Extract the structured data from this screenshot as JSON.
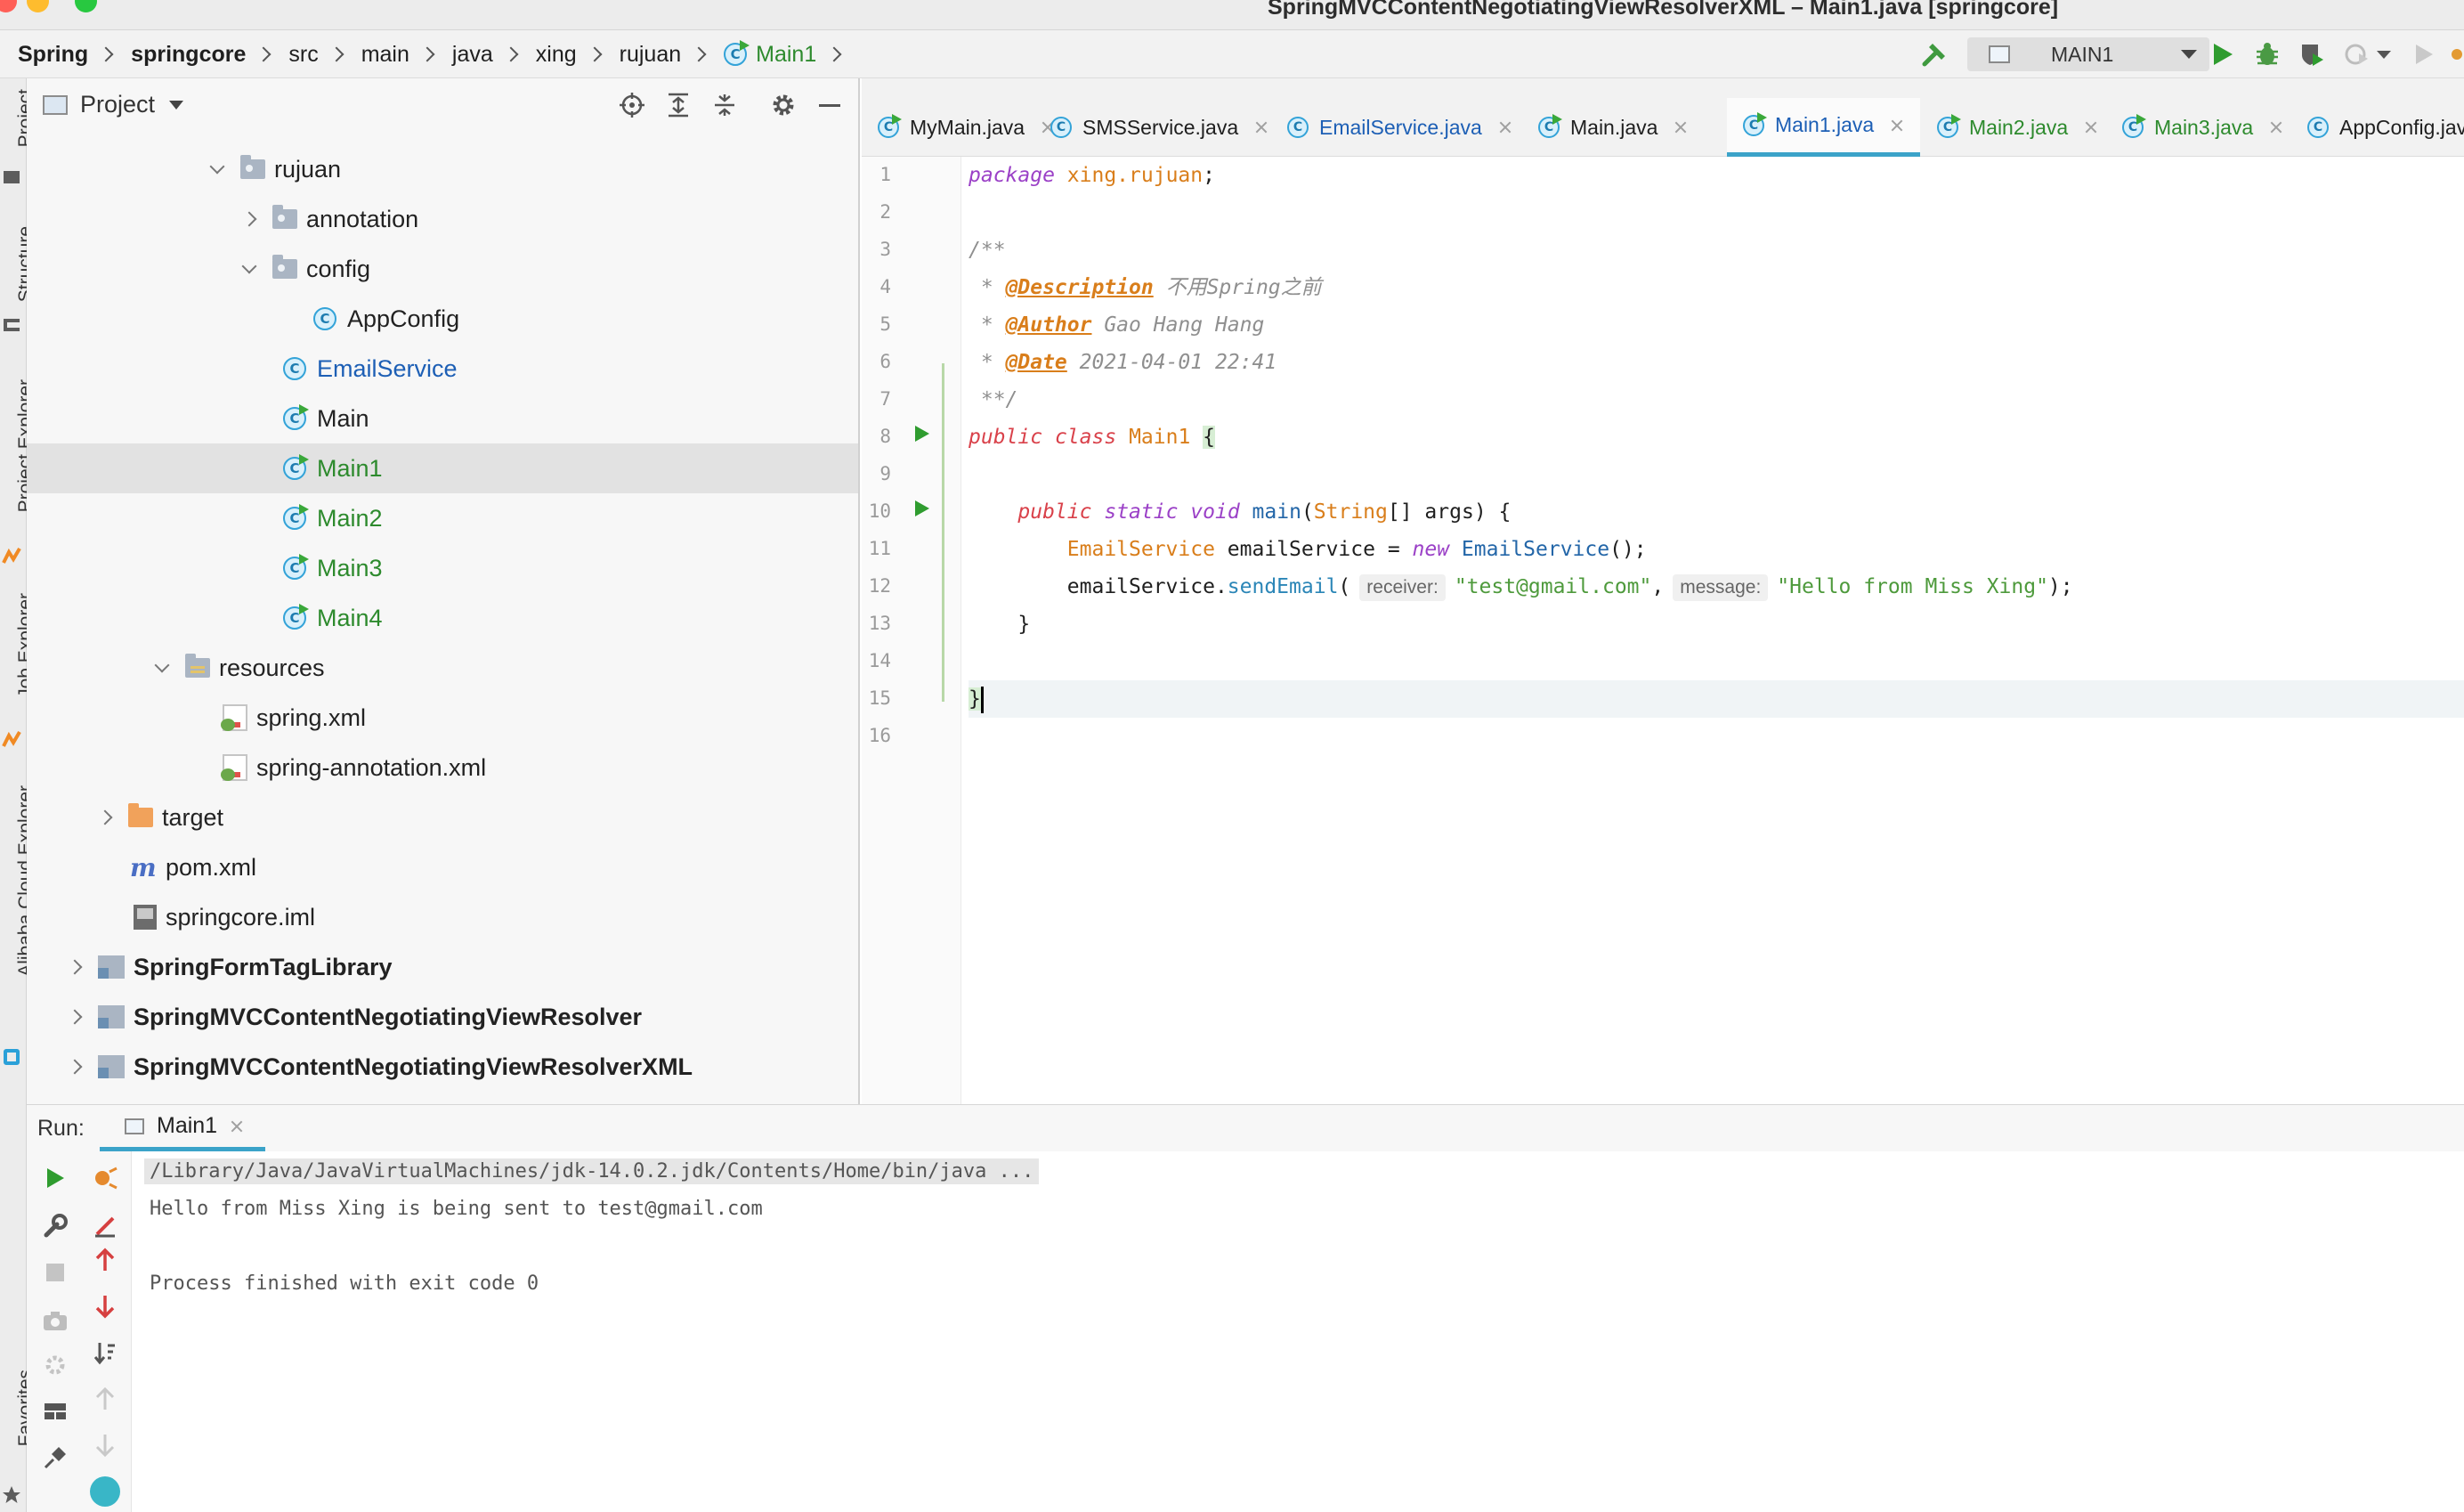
{
  "window": {
    "title": "SpringMVCContentNegotiatingViewResolverXML – Main1.java [springcore]"
  },
  "breadcrumb": {
    "items": [
      "Spring",
      "springcore",
      "src",
      "main",
      "java",
      "xing",
      "rujuan"
    ],
    "current": "Main1"
  },
  "toolbar": {
    "run_config": "MAIN1"
  },
  "left_strip": {
    "tabs": [
      "Project",
      "Structure",
      "Project Explorer",
      "Job Explorer",
      "Alibaba Cloud Explorer",
      "Favorites"
    ]
  },
  "project_panel": {
    "title": "Project",
    "tree": [
      {
        "label": "rujuan",
        "type": "package",
        "expanded": true
      },
      {
        "label": "annotation",
        "type": "package",
        "expanded": false
      },
      {
        "label": "config",
        "type": "package",
        "expanded": true
      },
      {
        "label": "AppConfig",
        "type": "class"
      },
      {
        "label": "EmailService",
        "type": "class"
      },
      {
        "label": "Main",
        "type": "runnable-class"
      },
      {
        "label": "Main1",
        "type": "runnable-class",
        "selected": true
      },
      {
        "label": "Main2",
        "type": "runnable-class"
      },
      {
        "label": "Main3",
        "type": "runnable-class"
      },
      {
        "label": "Main4",
        "type": "runnable-class"
      },
      {
        "label": "resources",
        "type": "resources-folder",
        "expanded": true
      },
      {
        "label": "spring.xml",
        "type": "xml"
      },
      {
        "label": "spring-annotation.xml",
        "type": "xml"
      },
      {
        "label": "target",
        "type": "excluded-folder",
        "expanded": false
      },
      {
        "label": "pom.xml",
        "type": "maven"
      },
      {
        "label": "springcore.iml",
        "type": "iml"
      },
      {
        "label": "SpringFormTagLibrary",
        "type": "module",
        "expanded": false
      },
      {
        "label": "SpringMVCContentNegotiatingViewResolver",
        "type": "module",
        "expanded": false
      },
      {
        "label": "SpringMVCContentNegotiatingViewResolverXML",
        "type": "module",
        "expanded": false
      }
    ]
  },
  "editor": {
    "tabs": [
      {
        "label": "MyMain.java"
      },
      {
        "label": "SMSService.java"
      },
      {
        "label": "EmailService.java"
      },
      {
        "label": "Main.java"
      },
      {
        "label": "Main1.java",
        "active": true
      },
      {
        "label": "Main2.java"
      },
      {
        "label": "Main3.java"
      },
      {
        "label": "AppConfig.java"
      }
    ],
    "line_numbers": [
      "1",
      "2",
      "3",
      "4",
      "5",
      "6",
      "7",
      "8",
      "9",
      "10",
      "11",
      "12",
      "13",
      "14",
      "15",
      "16"
    ],
    "current_line": 15,
    "code": {
      "l1_kw": "package",
      "l1_pkg": "xing.rujuan",
      "l1_end": ";",
      "l3": "/**",
      "l4_star": " * ",
      "l4_tag": "@Description",
      "l4_text": " 不用Spring之前",
      "l5_star": " * ",
      "l5_tag": "@Author",
      "l5_text": " Gao Hang Hang",
      "l6_star": " * ",
      "l6_tag": "@Date",
      "l6_text": " 2021-04-01 22:41",
      "l7": " **/",
      "l8_kw1": "public",
      "l8_kw2": "class",
      "l8_name": "Main1",
      "l8_brace": "{",
      "l10_kw1": "public",
      "l10_kw2": "static",
      "l10_kw3": "void",
      "l10_method": "main",
      "l10_paren": "(",
      "l10_type": "String",
      "l10_args": "[] args) {",
      "l11_type": "EmailService",
      "l11_var": " emailService = ",
      "l11_new": "new",
      "l11_ctor": "EmailService",
      "l11_end": "();",
      "l12_obj": "emailService.",
      "l12_method": "sendEmail",
      "l12_open": "(",
      "l12_hint1": "receiver:",
      "l12_str1": "\"test@gmail.com\"",
      "l12_comma": ",",
      "l12_hint2": "message:",
      "l12_str2": "\"Hello from Miss Xing\"",
      "l12_end": ");",
      "l13": "}",
      "l15": "}"
    }
  },
  "run_panel": {
    "label": "Run:",
    "tab": "Main1",
    "console": [
      "/Library/Java/JavaVirtualMachines/jdk-14.0.2.jdk/Contents/Home/bin/java ...",
      "Hello from Miss Xing is being sent to test@gmail.com",
      "",
      "Process finished with exit code 0"
    ]
  },
  "colors": {
    "accent": "#3ba3c9",
    "keyword": "#9b41c7",
    "string": "#4e9a3c",
    "class_name": "#d97e1b",
    "run_green": "#2f9c2f"
  }
}
